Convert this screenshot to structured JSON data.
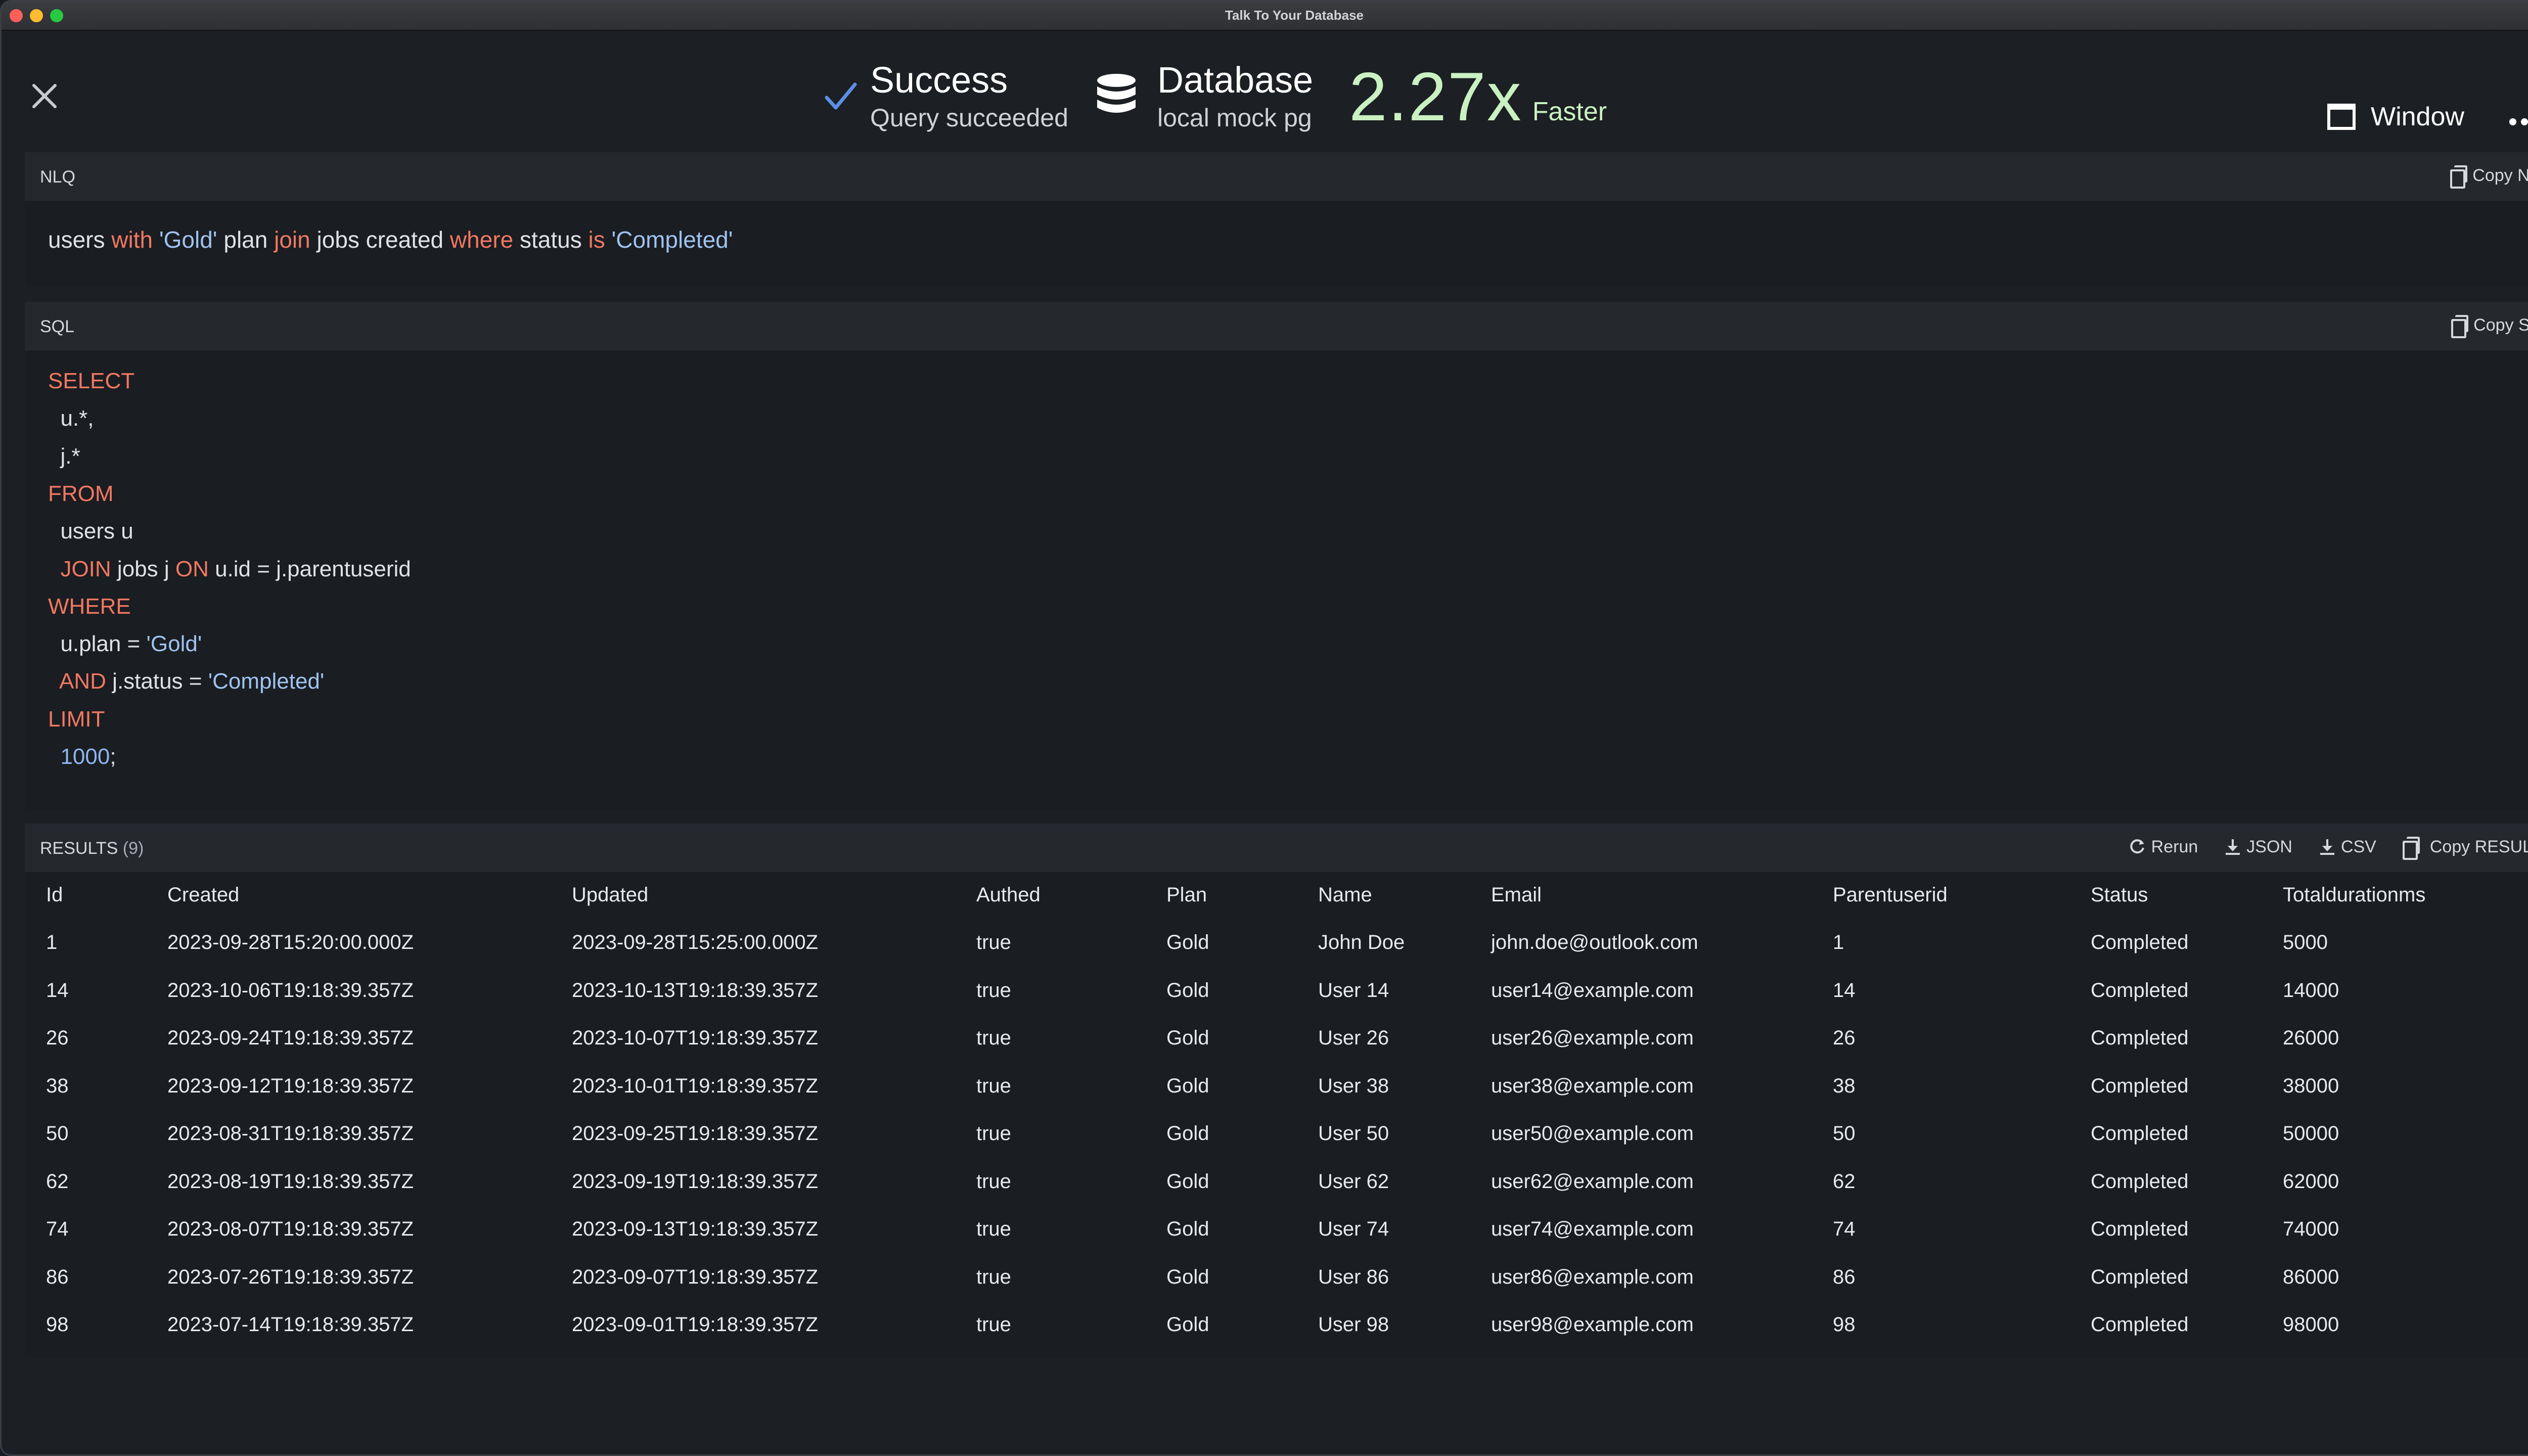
{
  "window": {
    "title": "Talk To Your Database"
  },
  "header": {
    "status_title": "Success",
    "status_subtitle": "Query succeeded",
    "db_title": "Database",
    "db_subtitle": "local mock pg",
    "speed_factor": "2.27x",
    "speed_label": "Faster",
    "window_label": "Window"
  },
  "nlq": {
    "label": "NLQ",
    "copy_label": "Copy NLQ",
    "tokens": [
      {
        "t": "users ",
        "k": "plain"
      },
      {
        "t": "with",
        "k": "kw"
      },
      {
        "t": " ",
        "k": "plain"
      },
      {
        "t": "'Gold'",
        "k": "str"
      },
      {
        "t": " plan ",
        "k": "plain"
      },
      {
        "t": "join",
        "k": "kw"
      },
      {
        "t": " jobs created ",
        "k": "plain"
      },
      {
        "t": "where",
        "k": "kw"
      },
      {
        "t": " status ",
        "k": "plain"
      },
      {
        "t": "is",
        "k": "kw"
      },
      {
        "t": " ",
        "k": "plain"
      },
      {
        "t": "'Completed'",
        "k": "str"
      }
    ]
  },
  "sql": {
    "label": "SQL",
    "copy_label": "Copy SQL",
    "lines": [
      [
        {
          "t": "SELECT",
          "k": "kw"
        }
      ],
      [
        {
          "t": "  u.*,",
          "k": "plain"
        }
      ],
      [
        {
          "t": "  j.*",
          "k": "plain"
        }
      ],
      [
        {
          "t": "FROM",
          "k": "kw"
        }
      ],
      [
        {
          "t": "  users u",
          "k": "plain"
        }
      ],
      [
        {
          "t": "  ",
          "k": "plain"
        },
        {
          "t": "JOIN",
          "k": "kw"
        },
        {
          "t": " jobs j ",
          "k": "plain"
        },
        {
          "t": "ON",
          "k": "kw"
        },
        {
          "t": " u.id = j.parentuserid",
          "k": "plain"
        }
      ],
      [
        {
          "t": "WHERE",
          "k": "kw"
        }
      ],
      [
        {
          "t": "  u.plan = ",
          "k": "plain"
        },
        {
          "t": "'Gold'",
          "k": "str"
        }
      ],
      [
        {
          "t": "  ",
          "k": "plain"
        },
        {
          "t": "AND",
          "k": "kw"
        },
        {
          "t": " j.status = ",
          "k": "plain"
        },
        {
          "t": "'Completed'",
          "k": "str"
        }
      ],
      [
        {
          "t": "LIMIT",
          "k": "kw"
        }
      ],
      [
        {
          "t": "  ",
          "k": "plain"
        },
        {
          "t": "1000",
          "k": "num"
        },
        {
          "t": ";",
          "k": "plain"
        }
      ]
    ]
  },
  "results": {
    "label": "RESULTS",
    "count": "(9)",
    "actions": {
      "rerun": "Rerun",
      "json": "JSON",
      "csv": "CSV",
      "copy": "Copy RESULTS"
    },
    "columns": [
      "Id",
      "Created",
      "Updated",
      "Authed",
      "Plan",
      "Name",
      "Email",
      "Parentuserid",
      "Status",
      "Totaldurationms"
    ],
    "rows": [
      [
        "1",
        "2023-09-28T15:20:00.000Z",
        "2023-09-28T15:25:00.000Z",
        "true",
        "Gold",
        "John Doe",
        "john.doe@outlook.com",
        "1",
        "Completed",
        "5000"
      ],
      [
        "14",
        "2023-10-06T19:18:39.357Z",
        "2023-10-13T19:18:39.357Z",
        "true",
        "Gold",
        "User 14",
        "user14@example.com",
        "14",
        "Completed",
        "14000"
      ],
      [
        "26",
        "2023-09-24T19:18:39.357Z",
        "2023-10-07T19:18:39.357Z",
        "true",
        "Gold",
        "User 26",
        "user26@example.com",
        "26",
        "Completed",
        "26000"
      ],
      [
        "38",
        "2023-09-12T19:18:39.357Z",
        "2023-10-01T19:18:39.357Z",
        "true",
        "Gold",
        "User 38",
        "user38@example.com",
        "38",
        "Completed",
        "38000"
      ],
      [
        "50",
        "2023-08-31T19:18:39.357Z",
        "2023-09-25T19:18:39.357Z",
        "true",
        "Gold",
        "User 50",
        "user50@example.com",
        "50",
        "Completed",
        "50000"
      ],
      [
        "62",
        "2023-08-19T19:18:39.357Z",
        "2023-09-19T19:18:39.357Z",
        "true",
        "Gold",
        "User 62",
        "user62@example.com",
        "62",
        "Completed",
        "62000"
      ],
      [
        "74",
        "2023-08-07T19:18:39.357Z",
        "2023-09-13T19:18:39.357Z",
        "true",
        "Gold",
        "User 74",
        "user74@example.com",
        "74",
        "Completed",
        "74000"
      ],
      [
        "86",
        "2023-07-26T19:18:39.357Z",
        "2023-09-07T19:18:39.357Z",
        "true",
        "Gold",
        "User 86",
        "user86@example.com",
        "86",
        "Completed",
        "86000"
      ],
      [
        "98",
        "2023-07-14T19:18:39.357Z",
        "2023-09-01T19:18:39.357Z",
        "true",
        "Gold",
        "User 98",
        "user98@example.com",
        "98",
        "Completed",
        "98000"
      ]
    ]
  },
  "colors": {
    "keyword": "#f07862",
    "string": "#9fc3f0",
    "speed": "#c9f1c2",
    "success_check": "#5b8fe8"
  },
  "icons": [
    "close-icon",
    "check-icon",
    "database-icon",
    "window-icon",
    "more-icon",
    "copy-icon",
    "rerun-icon",
    "download-icon"
  ]
}
